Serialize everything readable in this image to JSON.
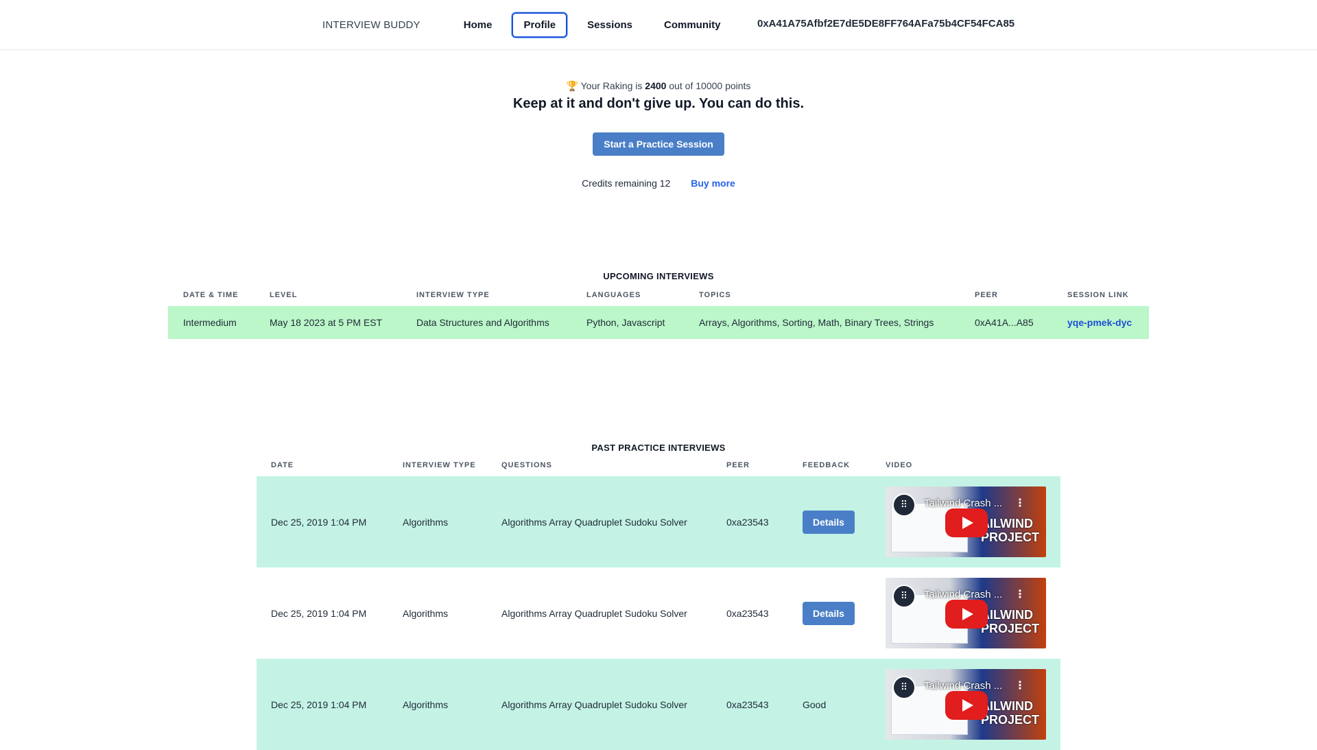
{
  "nav": {
    "brand": "INTERVIEW BUDDY",
    "links": [
      "Home",
      "Profile",
      "Sessions",
      "Community"
    ],
    "active": "Profile",
    "wallet": "0xA41A75Afbf2E7dE5DE8FF764AFa75b4CF54FCA85"
  },
  "hero": {
    "trophy": "🏆",
    "ranking_prefix": "Your Raking is",
    "ranking_value": "2400",
    "ranking_suffix": "out of 10000 points",
    "motto": "Keep at it and don't give up. You can do this.",
    "start_button": "Start a Practice Session",
    "credits_label": "Credits remaining 12",
    "buy_more": "Buy more"
  },
  "upcoming": {
    "title": "UPCOMING INTERVIEWS",
    "headers": [
      "DATE & TIME",
      "LEVEL",
      "INTERVIEW TYPE",
      "LANGUAGES",
      "TOPICS",
      "PEER",
      "SESSION LINK"
    ],
    "rows": [
      {
        "c0": "Intermedium",
        "c1": "May 18 2023 at 5 PM EST",
        "c2": "Data Structures and Algorithms",
        "c3": "Python, Javascript",
        "c4": "Arrays, Algorithms, Sorting, Math, Binary Trees, Strings",
        "c5": "0xA41A...A85",
        "c6": "yqe-pmek-dyc"
      }
    ]
  },
  "past": {
    "title": "PAST PRACTICE INTERVIEWS",
    "headers": [
      "DATE",
      "INTERVIEW TYPE",
      "QUESTIONS",
      "PEER",
      "FEEDBACK",
      "VIDEO"
    ],
    "rows": [
      {
        "date": "Dec 25, 2019 1:04 PM",
        "type": "Algorithms",
        "questions": "Algorithms Array Quadruplet Sudoku Solver",
        "peer": "0xa23543",
        "feedback": "Details"
      },
      {
        "date": "Dec 25, 2019 1:04 PM",
        "type": "Algorithms",
        "questions": "Algorithms Array Quadruplet Sudoku Solver",
        "peer": "0xa23543",
        "feedback": "Details"
      },
      {
        "date": "Dec 25, 2019 1:04 PM",
        "type": "Algorithms",
        "questions": "Algorithms Array Quadruplet Sudoku Solver",
        "peer": "0xa23543",
        "feedback": "Good"
      }
    ],
    "video": {
      "title": "Tailwind Crash ...",
      "line1": "AILWIND",
      "line2": "PROJECT"
    }
  }
}
